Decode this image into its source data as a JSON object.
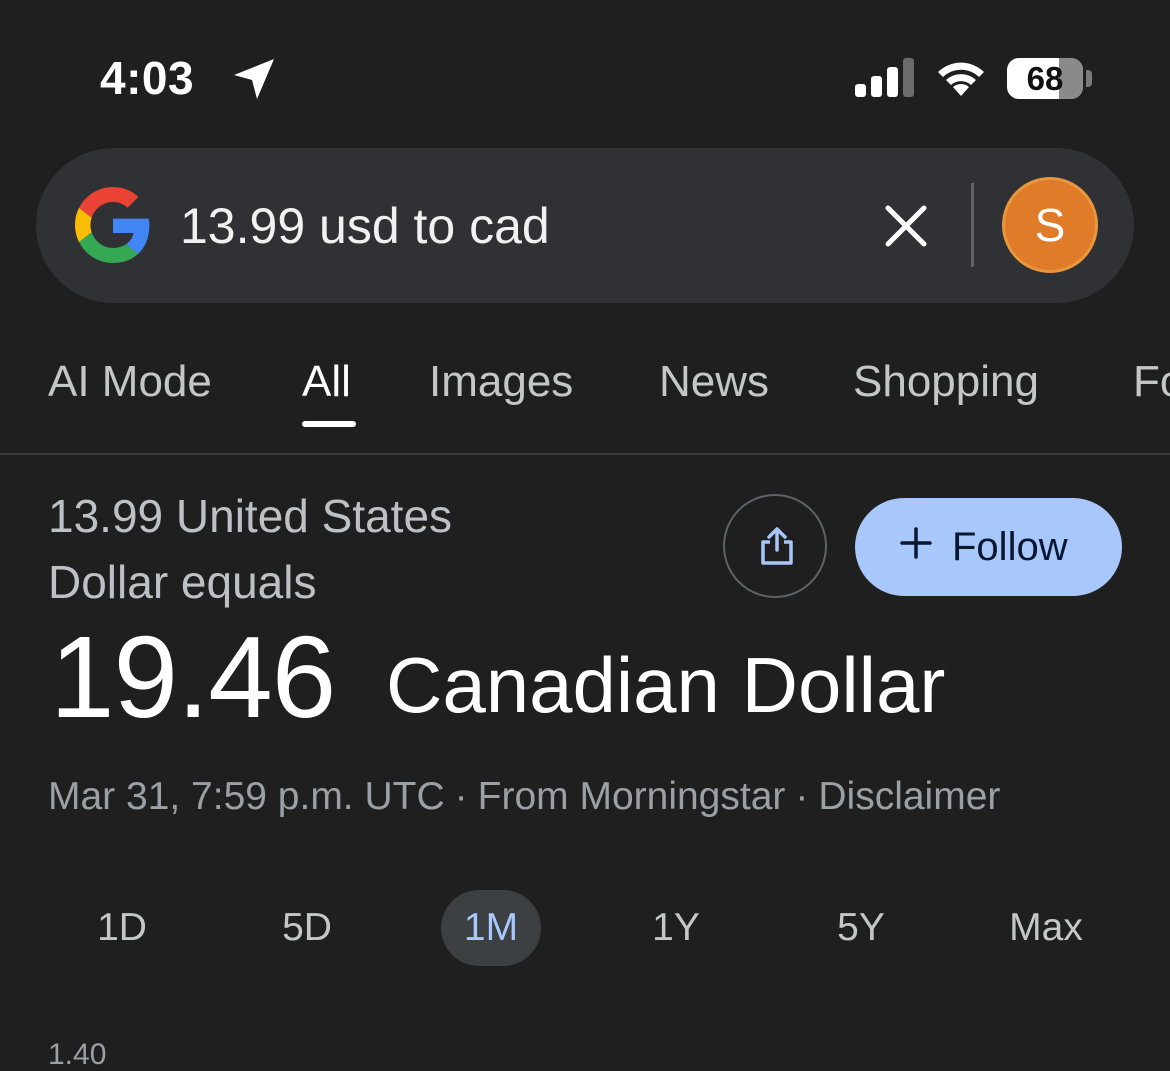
{
  "status_bar": {
    "time": "4:03",
    "battery_level": "68",
    "battery_fraction": 0.68
  },
  "search": {
    "query": "13.99 usd to cad",
    "avatar_letter": "S",
    "logo_colors": [
      "#4285F4",
      "#EA4335",
      "#FBBC05",
      "#34A853"
    ],
    "avatar_color": "#E07B2A"
  },
  "tabs": [
    {
      "label": "AI Mode",
      "active": false
    },
    {
      "label": "All",
      "active": true
    },
    {
      "label": "Images",
      "active": false
    },
    {
      "label": "News",
      "active": false
    },
    {
      "label": "Shopping",
      "active": false
    },
    {
      "label": "Fo",
      "active": false
    }
  ],
  "result": {
    "from_line_1": "13.99 United States",
    "from_line_2": "Dollar equals",
    "amount": "19.46",
    "currency": "Canadian Dollar",
    "follow_label": "Follow",
    "timestamp": "Mar 31, 7:59 p.m. UTC",
    "separator": "·",
    "source": "From Morningstar",
    "disclaimer": "Disclaimer"
  },
  "ranges": [
    {
      "label": "1D",
      "active": false
    },
    {
      "label": "5D",
      "active": false
    },
    {
      "label": "1M",
      "active": true
    },
    {
      "label": "1Y",
      "active": false
    },
    {
      "label": "5Y",
      "active": false
    },
    {
      "label": "Max",
      "active": false
    }
  ],
  "chart_partial_label": "1.40",
  "colors": {
    "background": "#1F1F1F",
    "search_bg": "#303134",
    "follow_bg": "#A8C7FA",
    "active_range_text": "#A8C7FA"
  },
  "icons": [
    "location-arrow-icon",
    "cellular-signal-icon",
    "wifi-icon",
    "battery-icon",
    "google-logo-icon",
    "close-icon",
    "share-icon",
    "plus-icon"
  ]
}
